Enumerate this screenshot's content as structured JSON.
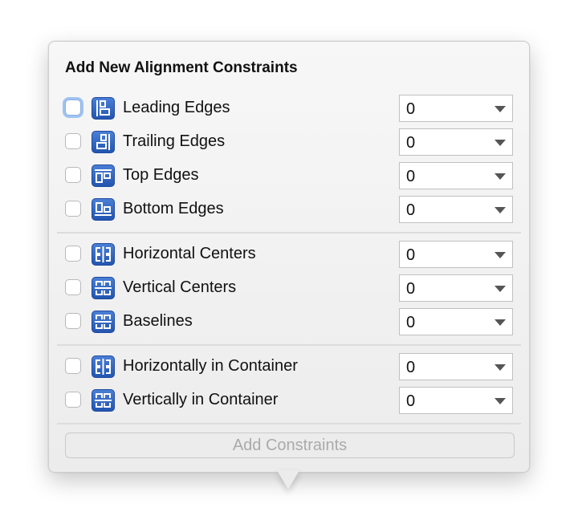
{
  "popover": {
    "title": "Add New Alignment Constraints",
    "groups": [
      [
        {
          "label": "Leading Edges",
          "icon": "leading-edges-icon",
          "value": "0",
          "checked": false,
          "focused": true
        },
        {
          "label": "Trailing Edges",
          "icon": "trailing-edges-icon",
          "value": "0",
          "checked": false
        },
        {
          "label": "Top Edges",
          "icon": "top-edges-icon",
          "value": "0",
          "checked": false
        },
        {
          "label": "Bottom Edges",
          "icon": "bottom-edges-icon",
          "value": "0",
          "checked": false
        }
      ],
      [
        {
          "label": "Horizontal Centers",
          "icon": "horizontal-centers-icon",
          "value": "0",
          "checked": false
        },
        {
          "label": "Vertical Centers",
          "icon": "vertical-centers-icon",
          "value": "0",
          "checked": false
        },
        {
          "label": "Baselines",
          "icon": "baselines-icon",
          "value": "0",
          "checked": false
        }
      ],
      [
        {
          "label": "Horizontally in Container",
          "icon": "horizontal-centers-icon",
          "value": "0",
          "checked": false
        },
        {
          "label": "Vertically in Container",
          "icon": "vertical-centers-icon",
          "value": "0",
          "checked": false
        }
      ]
    ],
    "add_button_label": "Add Constraints",
    "add_button_enabled": false
  }
}
